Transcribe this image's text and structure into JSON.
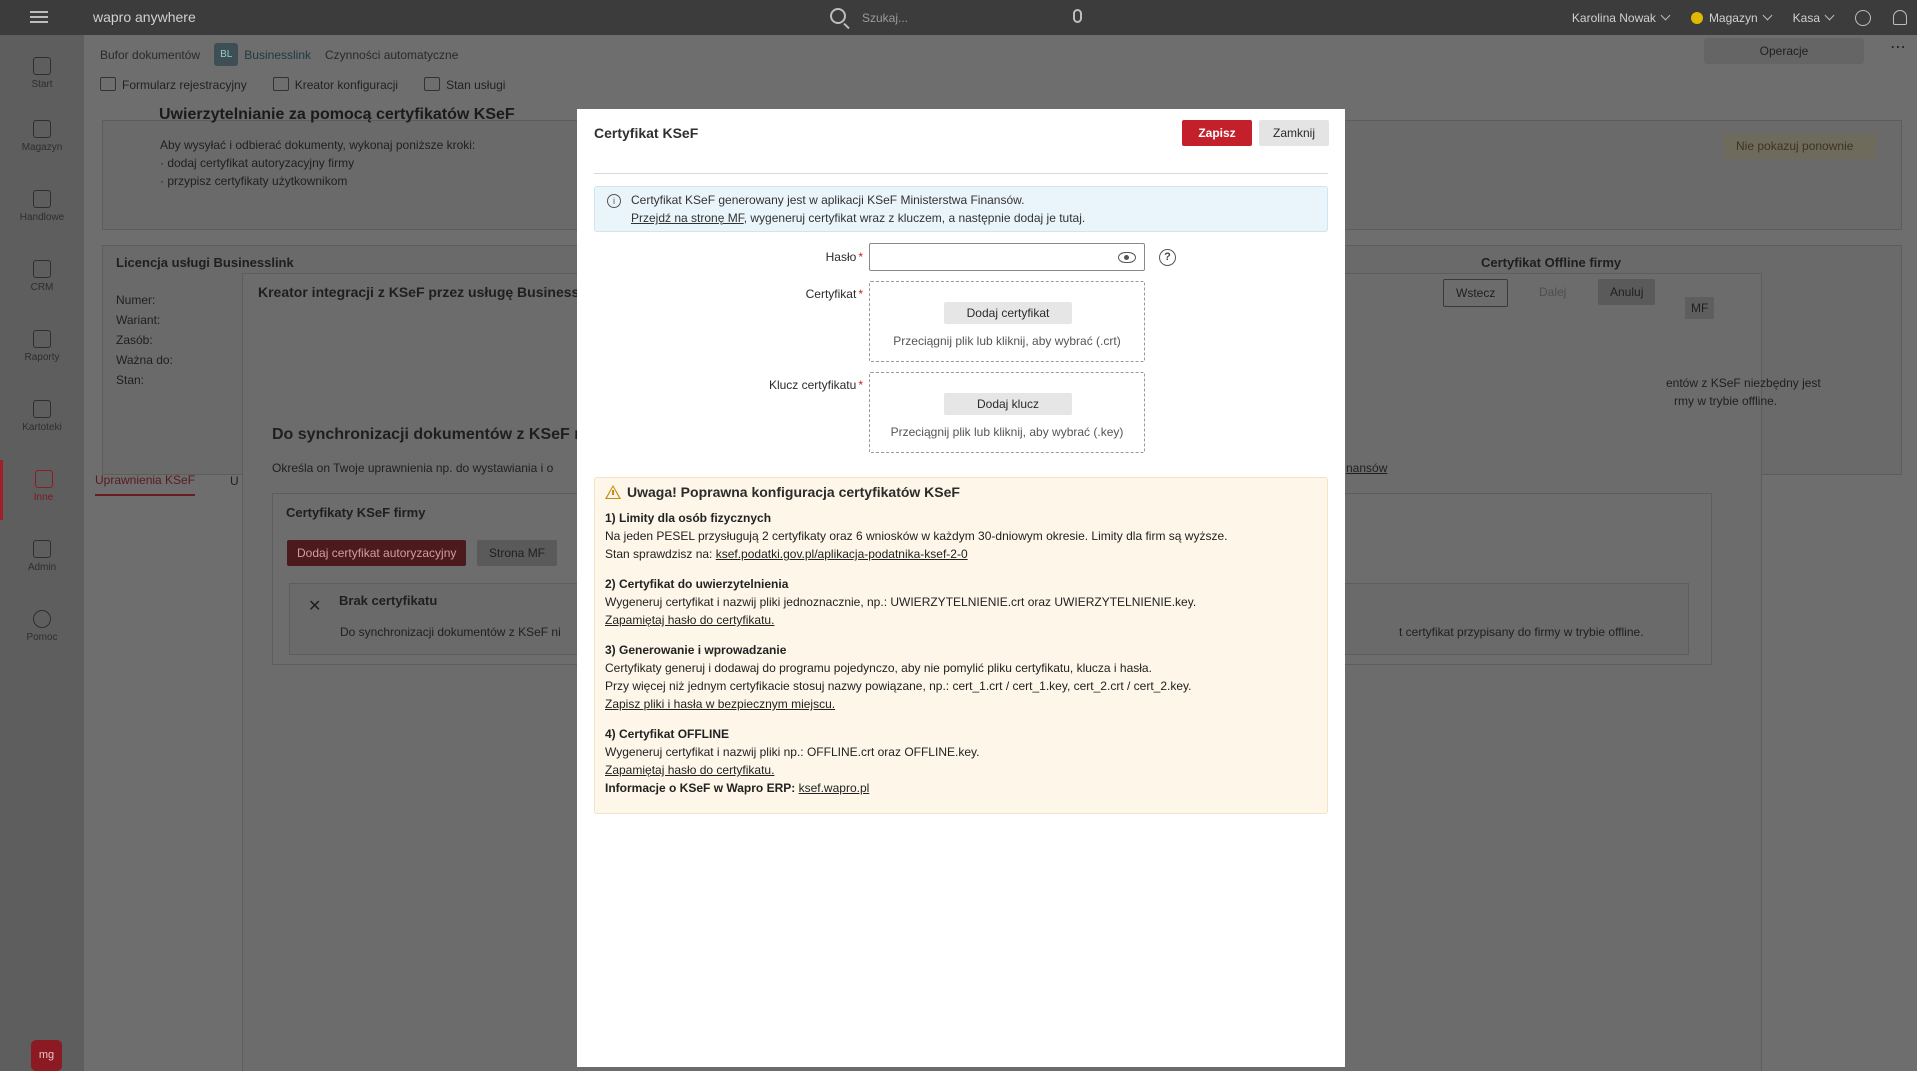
{
  "topbar": {
    "brand": "wapro anywhere",
    "search_placeholder": "Szukaj...",
    "user": "Karolina Nowak",
    "magazyn": "Magazyn",
    "kasa": "Kasa"
  },
  "sidebar": {
    "items": [
      {
        "label": "Start"
      },
      {
        "label": "Magazyn"
      },
      {
        "label": "Handlowe"
      },
      {
        "label": "CRM"
      },
      {
        "label": "Raporty"
      },
      {
        "label": "Kartoteki"
      },
      {
        "label": "Inne"
      },
      {
        "label": "Admin"
      },
      {
        "label": "Pomoc"
      }
    ],
    "logo": "mg"
  },
  "background": {
    "subnav": [
      "Bufor dokumentów",
      "BL",
      "Businesslink",
      "Czynności automatyczne"
    ],
    "toolbar": [
      "Formularz rejestracyjny",
      "Kreator konfiguracji",
      "Stan usługi"
    ],
    "operacje": "Operacje",
    "warn_title": "Uwierzytelnianie za pomocą certyfikatów KSeF",
    "warn_lines": [
      "Aby wysyłać i odbierać dokumenty, wykonaj poniższe kroki:",
      "· dodaj certyfikat autoryzacyjny firmy",
      "· przypisz certyfikaty użytkownikom"
    ],
    "nie_pokazuj": "Nie pokazuj ponownie",
    "licencja": "Licencja usługi Businesslink",
    "lic_fields": [
      "Numer:",
      "Wariant:",
      "Zasób:",
      "Ważna do:",
      "Stan:"
    ],
    "cert_offline": "Certyfikat Offline firmy",
    "kreator": "Kreator integracji z KSeF przez usługę Businesslink",
    "wstecz": "Wstecz",
    "dalej": "Dalej",
    "anuluj": "Anuluj",
    "mf": "MF",
    "offline_text1": "entów z KSeF niezbędny jest",
    "offline_text2": "rmy w trybie offline.",
    "sync_title": "Do synchronizacji dokumentów z KSeF nie",
    "sync_sub": "Określa on Twoje uprawnienia np. do wystawiania i o",
    "nansow": "nansów",
    "tab_active": "Uprawnienia KSeF",
    "tab_other": "U",
    "firm_certs": "Certyfikaty KSeF firmy",
    "add_auth_cert": "Dodaj certyfikat autoryzacyjny",
    "strona_mf": "Strona MF",
    "brak": "Brak certyfikatu",
    "brak_text": "Do synchronizacji dokumentów z KSeF ni",
    "offline_assigned": "t certyfikat przypisany do firmy w trybie offline."
  },
  "modal": {
    "title": "Certyfikat KSeF",
    "save": "Zapisz",
    "close": "Zamknij",
    "info_line1": "Certyfikat KSeF generowany jest w aplikacji KSeF Ministerstwa Finansów.",
    "info_link": "Przejdź na stronę MF",
    "info_line2_rest": ", wygeneruj certyfikat wraz z kluczem, a następnie dodaj je tutaj.",
    "password_label": "Hasło",
    "password_value": "",
    "cert_label": "Certyfikat",
    "cert_button": "Dodaj certyfikat",
    "cert_hint": "Przeciągnij plik lub kliknij, aby wybrać (.crt)",
    "key_label": "Klucz certyfikatu",
    "key_button": "Dodaj klucz",
    "key_hint": "Przeciągnij plik lub kliknij, aby wybrać (.key)",
    "warning": {
      "title": "Uwaga! Poprawna konfiguracja certyfikatów KSeF",
      "s1_head": "1) Limity dla osób fizycznych",
      "s1_l1": "Na jeden PESEL przysługują 2 certyfikaty oraz 6 wniosków w każdym 30-dniowym okresie. Limity dla firm są wyższe.",
      "s1_l2_prefix": "Stan sprawdzisz na: ",
      "s1_link": "ksef.podatki.gov.pl/aplikacja-podatnika-ksef-2-0",
      "s2_head": "2) Certyfikat do uwierzytelnienia",
      "s2_l1": "Wygeneruj certyfikat i nazwij pliki jednoznacznie, np.: UWIERZYTELNIENIE.crt oraz UWIERZYTELNIENIE.key.",
      "s2_link": "Zapamiętaj hasło do certyfikatu.",
      "s3_head": "3) Generowanie i wprowadzanie",
      "s3_l1": "Certyfikaty generuj i dodawaj do programu pojedynczo, aby nie pomylić pliku certyfikatu, klucza i hasła.",
      "s3_l2": "Przy więcej niż jednym certyfikacie stosuj nazwy powiązane, np.: cert_1.crt / cert_1.key, cert_2.crt / cert_2.key.",
      "s3_link": "Zapisz pliki i hasła w bezpiecznym miejscu.",
      "s4_head": "4) Certyfikat OFFLINE",
      "s4_l1": "Wygeneruj certyfikat i nazwij pliki np.: OFFLINE.crt oraz OFFLINE.key.",
      "s4_link": "Zapamiętaj hasło do certyfikatu.",
      "info_prefix": "Informacje o KSeF w Wapro ERP: ",
      "info_link": "ksef.wapro.pl"
    }
  }
}
